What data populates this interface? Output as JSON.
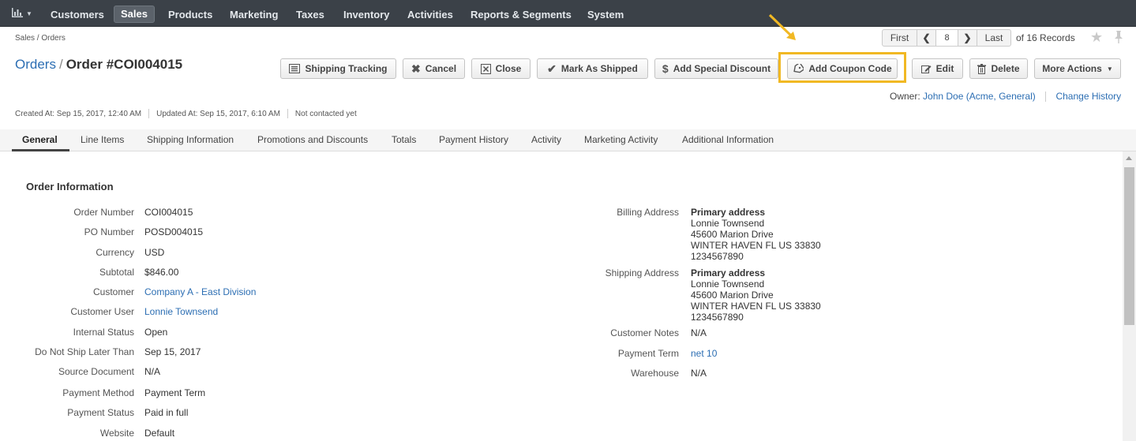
{
  "nav": {
    "items": [
      "Customers",
      "Sales",
      "Products",
      "Marketing",
      "Taxes",
      "Inventory",
      "Activities",
      "Reports & Segments",
      "System"
    ],
    "active": "Sales",
    "dashboard_icon": "bar-chart-icon"
  },
  "breadcrumb": "Sales / Orders",
  "pager": {
    "first": "First",
    "page": "8",
    "last": "Last",
    "records": "of 16 Records"
  },
  "title": {
    "link": "Orders",
    "separator": "/",
    "current": "Order #COI004015"
  },
  "toolbar": {
    "shipping_tracking": "Shipping Tracking",
    "cancel": "Cancel",
    "close": "Close",
    "mark_shipped": "Mark As Shipped",
    "add_discount": "Add Special Discount",
    "add_coupon": "Add Coupon Code",
    "edit": "Edit",
    "delete": "Delete",
    "more_actions": "More Actions"
  },
  "owner": {
    "label": "Owner:",
    "name": "John Doe (Acme, General)",
    "change_history": "Change History"
  },
  "meta": {
    "created": "Created At: Sep 15, 2017, 12:40 AM",
    "updated": "Updated At: Sep 15, 2017, 6:10 AM",
    "contacted": "Not contacted yet"
  },
  "tabs": [
    "General",
    "Line Items",
    "Shipping Information",
    "Promotions and Discounts",
    "Totals",
    "Payment History",
    "Activity",
    "Marketing Activity",
    "Additional Information"
  ],
  "section": {
    "title": "Order Information",
    "left_fields": [
      {
        "label": "Order Number",
        "value": "COI004015"
      },
      {
        "label": "PO Number",
        "value": "POSD004015"
      },
      {
        "label": "Currency",
        "value": "USD"
      },
      {
        "label": "Subtotal",
        "value": "$846.00"
      },
      {
        "label": "Customer",
        "value": "Company A - East Division"
      },
      {
        "label": "Customer User",
        "value": "Lonnie Townsend"
      },
      {
        "label": "Internal Status",
        "value": "Open"
      },
      {
        "label": "Do Not Ship Later Than",
        "value": "Sep 15, 2017"
      },
      {
        "label": "Source Document",
        "value": "N/A"
      },
      {
        "label": "Payment Method",
        "value": "Payment Term"
      },
      {
        "label": "Payment Status",
        "value": "Paid in full"
      },
      {
        "label": "Website",
        "value": "Default"
      }
    ],
    "billing": {
      "label": "Billing Address",
      "title": "Primary address",
      "name": "Lonnie Townsend",
      "street": "45600 Marion Drive",
      "city": "WINTER HAVEN FL US 33830",
      "phone": "1234567890"
    },
    "shipping": {
      "label": "Shipping Address",
      "title": "Primary address",
      "name": "Lonnie Townsend",
      "street": "45600 Marion Drive",
      "city": "WINTER HAVEN FL US 33830",
      "phone": "1234567890"
    },
    "right_fields": [
      {
        "label": "Customer Notes",
        "value": "N/A"
      },
      {
        "label": "Payment Term",
        "value": "net 10"
      },
      {
        "label": "Warehouse",
        "value": "N/A"
      }
    ]
  },
  "colors": {
    "nav_bg": "#3b4148",
    "link": "#2c6eb3",
    "highlight": "#f1b823"
  }
}
